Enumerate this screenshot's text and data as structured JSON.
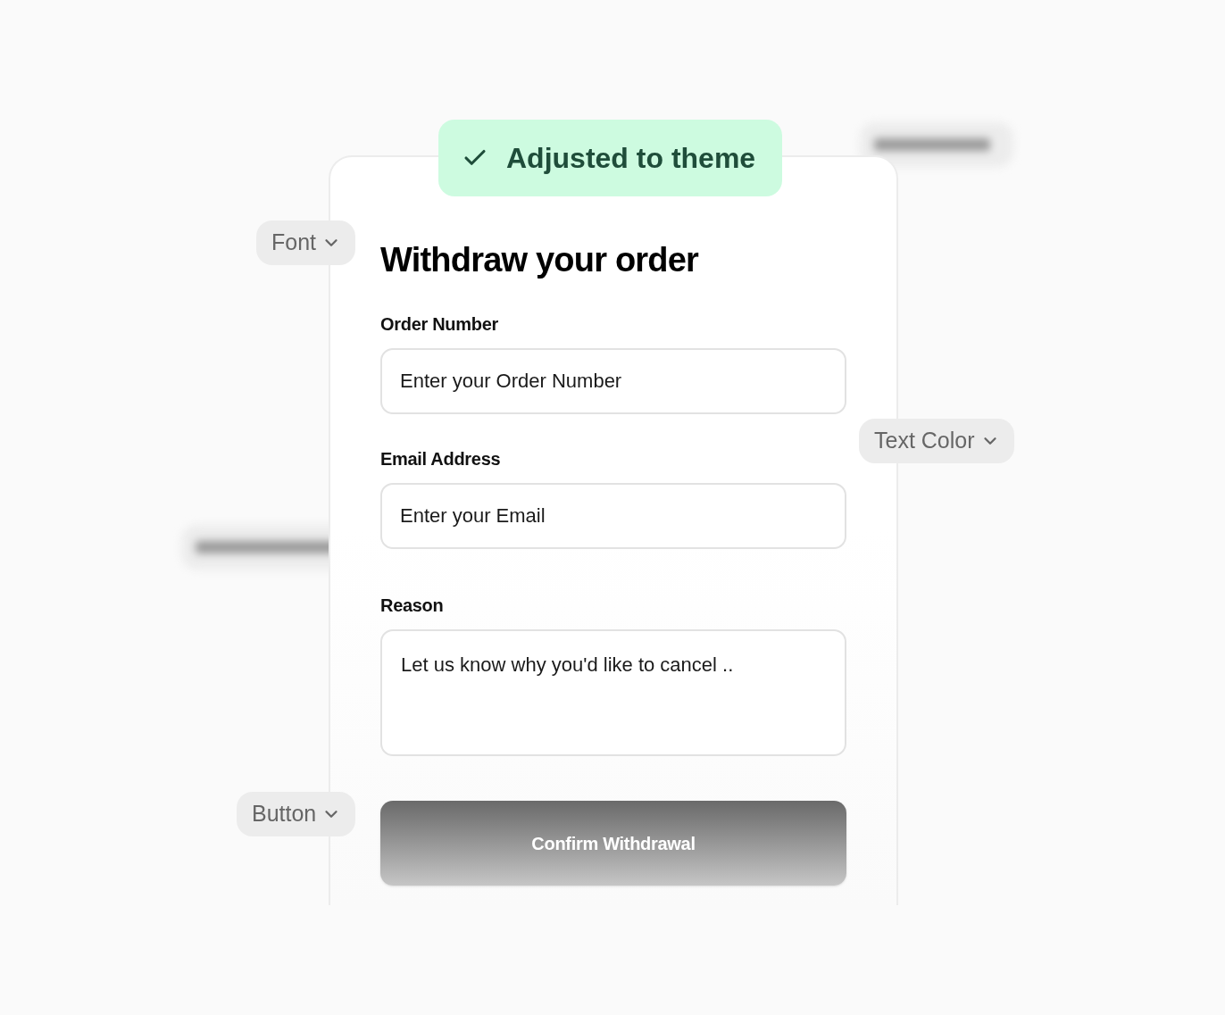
{
  "badge": {
    "label": "Adjusted to theme"
  },
  "form": {
    "title": "Withdraw your order",
    "fields": [
      {
        "kind": "input",
        "label": "Order Number",
        "placeholder": "Enter your Order Number"
      },
      {
        "kind": "input",
        "label": "Email Address",
        "placeholder": "Enter your Email"
      },
      {
        "kind": "textarea",
        "label": "Reason",
        "placeholder": "Let us know why you'd like to cancel .."
      }
    ],
    "submit": "Confirm Withdrawal"
  },
  "chips": [
    {
      "label": "Font"
    },
    {
      "label": "Text Color"
    },
    {
      "label": "Button"
    }
  ]
}
